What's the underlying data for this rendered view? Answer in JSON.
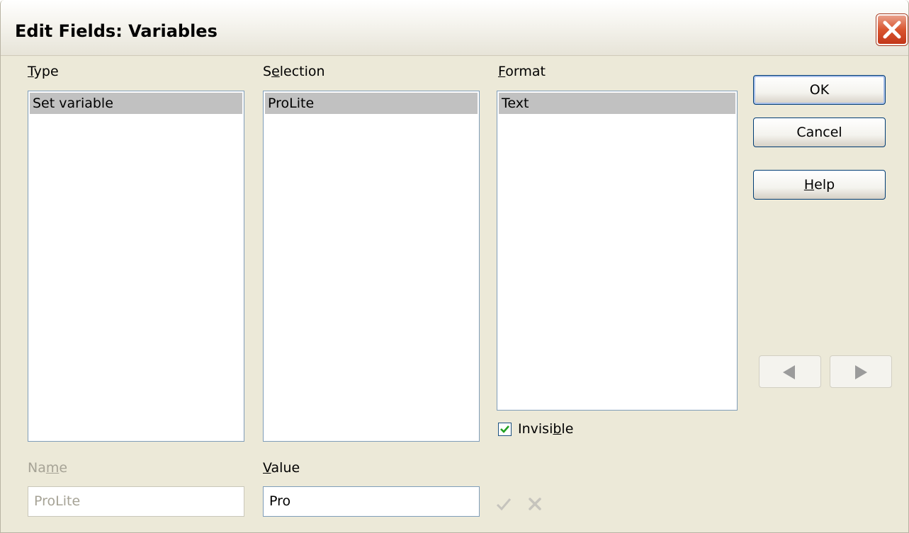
{
  "window": {
    "title": "Edit Fields: Variables"
  },
  "type": {
    "label_pre": "",
    "label_key": "T",
    "label_post": "ype",
    "items": [
      "Set variable"
    ]
  },
  "selection": {
    "label_pre": "S",
    "label_key": "e",
    "label_post": "lection",
    "items": [
      "ProLite"
    ]
  },
  "format": {
    "label_pre": "",
    "label_key": "F",
    "label_post": "ormat",
    "items": [
      "Text"
    ]
  },
  "invisible": {
    "label_pre": "Invisi",
    "label_key": "b",
    "label_post": "le",
    "checked": true
  },
  "name": {
    "label_pre": "Na",
    "label_key": "m",
    "label_post": "e",
    "value": "ProLite"
  },
  "value": {
    "label_pre": "",
    "label_key": "V",
    "label_post": "alue",
    "value": "Pro"
  },
  "buttons": {
    "ok": "OK",
    "cancel": "Cancel",
    "help_pre": "",
    "help_key": "H",
    "help_post": "elp"
  },
  "icons": {
    "close": "close-icon",
    "apply": "checkmark-icon",
    "delete": "delete-x-icon",
    "prev": "arrow-left-icon",
    "next": "arrow-right-icon"
  },
  "colors": {
    "title_close": "#d9552f",
    "selected_row": "#c1c1c1",
    "button_border": "#003c74",
    "checkbox_check": "#21a121"
  }
}
